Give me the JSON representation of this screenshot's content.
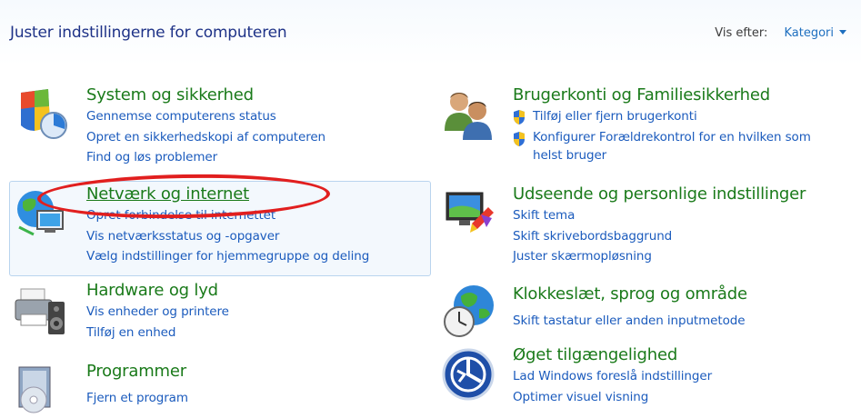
{
  "header": {
    "title": "Juster indstillingerne for computeren",
    "view_by_label": "Vis efter:",
    "view_by_value": "Kategori"
  },
  "categories": {
    "system": {
      "title": "System og sikkerhed",
      "links": [
        "Gennemse computerens status",
        "Opret en sikkerhedskopi af computeren",
        "Find og løs problemer"
      ]
    },
    "network": {
      "title": "Netværk og internet",
      "links": [
        "Opret forbindelse til internettet",
        "Vis netværksstatus og -opgaver",
        "Vælg indstillinger for hjemmegruppe og deling"
      ]
    },
    "hardware": {
      "title": "Hardware og lyd",
      "links": [
        "Vis enheder og printere",
        "Tilføj en enhed"
      ]
    },
    "programs": {
      "title": "Programmer",
      "links": [
        "Fjern et program"
      ]
    },
    "accounts": {
      "title": "Brugerkonti og Familiesikkerhed",
      "links": [
        "Tilføj eller fjern brugerkonti",
        "Konfigurer Forældrekontrol for en hvilken som helst bruger"
      ]
    },
    "appearance": {
      "title": "Udseende og personlige indstillinger",
      "links": [
        "Skift tema",
        "Skift skrivebordsbaggrund",
        "Juster skærmopløsning"
      ]
    },
    "clock": {
      "title": "Klokkeslæt, sprog og område",
      "links": [
        "Skift tastatur eller anden inputmetode"
      ]
    },
    "ease": {
      "title": "Øget tilgængelighed",
      "links": [
        "Lad Windows foreslå indstillinger",
        "Optimer visuel visning"
      ]
    }
  },
  "colors": {
    "category_title": "#1a7a1a",
    "link": "#1b5bbd",
    "header_title": "#1e3287",
    "annotation": "#e11f1f"
  }
}
